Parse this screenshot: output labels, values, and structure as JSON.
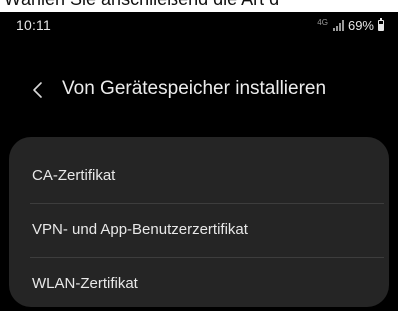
{
  "caption": {
    "text": "Wählen Sie anschließend die Art d"
  },
  "status_bar": {
    "time": "10:11",
    "network": "4G",
    "battery_percent": "69%",
    "battery_level": 0.69
  },
  "header": {
    "back_icon": "chevron-left-icon",
    "title": "Von Gerätespeicher installieren"
  },
  "certificate_list": {
    "items": [
      {
        "label": "CA-Zertifikat"
      },
      {
        "label": "VPN- und App-Benutzerzertifikat"
      },
      {
        "label": "WLAN-Zertifikat"
      }
    ]
  },
  "colors": {
    "background": "#000000",
    "card": "#252525",
    "divider": "#3d3d3d",
    "text": "#e8e8e8"
  }
}
